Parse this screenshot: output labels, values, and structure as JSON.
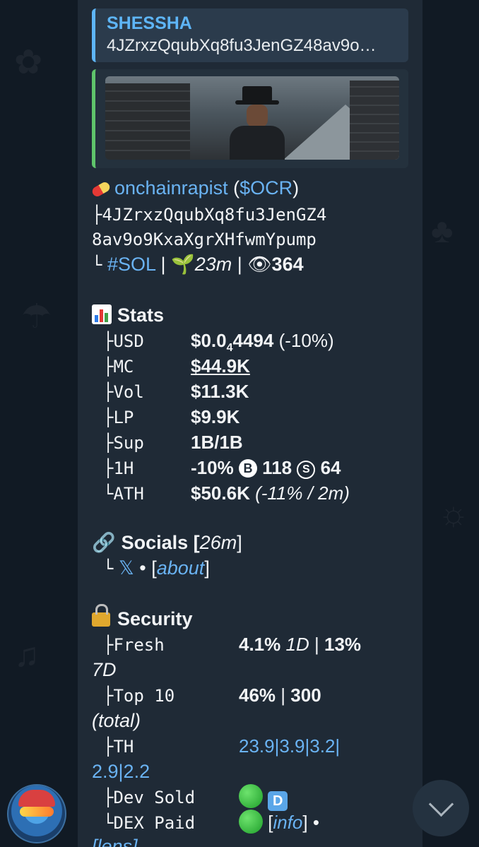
{
  "reply": {
    "name": "SHESSHA",
    "text": "4JZrxzQqubXq8fu3JenGZ48av9o…"
  },
  "token": {
    "name": "onchainrapist",
    "ticker_open": "(",
    "ticker": "$OCR",
    "ticker_close": ")",
    "address_line1": "├4JZrxzQqubXq8fu3JenGZ4",
    "address_line2": "8av9o9KxaXgrXHfwmYpump",
    "tree_end": "└",
    "chain": "#SOL",
    "sep": "|",
    "age": "23m",
    "views": "364"
  },
  "stats": {
    "title": "Stats",
    "rows": [
      {
        "label": "├USD",
        "value_a": "$0.0",
        "value_sub": "4",
        "value_b": "4494",
        "extra": "(-10%)"
      },
      {
        "label": "├MC",
        "value": "$44.9K"
      },
      {
        "label": "├Vol",
        "value": "$11.3K"
      },
      {
        "label": "├LP",
        "value": "$9.9K"
      },
      {
        "label": "├Sup",
        "value": "1B/1B"
      },
      {
        "label": "├1H",
        "value": "-10%",
        "b_icon": "B",
        "buys": "118",
        "s_icon": "S",
        "sells": "64"
      },
      {
        "label": "└ATH",
        "value": "$50.6K",
        "extra": "(-11% / 2m)"
      }
    ]
  },
  "socials": {
    "title": "Socials [",
    "age": "26m",
    "close": "]",
    "tree_end": "└",
    "x_link": "𝕏",
    "dot": "•",
    "about_open": "[",
    "about": "about",
    "about_close": "]"
  },
  "security": {
    "title": "Security",
    "fresh_label": "├Fresh",
    "fresh_a": "4.1%",
    "fresh_1d": "1D",
    "fresh_sep": "|",
    "fresh_b": "13%",
    "fresh_7d": "7D",
    "top10_label": "├Top 10",
    "top10_a": "46%",
    "top10_sep": "|",
    "top10_b": "300",
    "top10_total": "(total)",
    "th_label": "├TH",
    "th_line1": "23.9|3.9|3.2|",
    "th_line2": "2.9|2.2",
    "devsold_label": "├Dev Sold",
    "devsold_badge": "D",
    "dexpaid_label": "└DEX Paid",
    "info_open": "[",
    "info": "info",
    "info_close": "]",
    "info_dot": "•",
    "lens_partial": "[lens]"
  },
  "colors": {
    "link": "#6ab3f3",
    "bubble": "#1f2a36",
    "reply_bar": "#5eb5f7",
    "preview_bar": "#5fc46b"
  }
}
